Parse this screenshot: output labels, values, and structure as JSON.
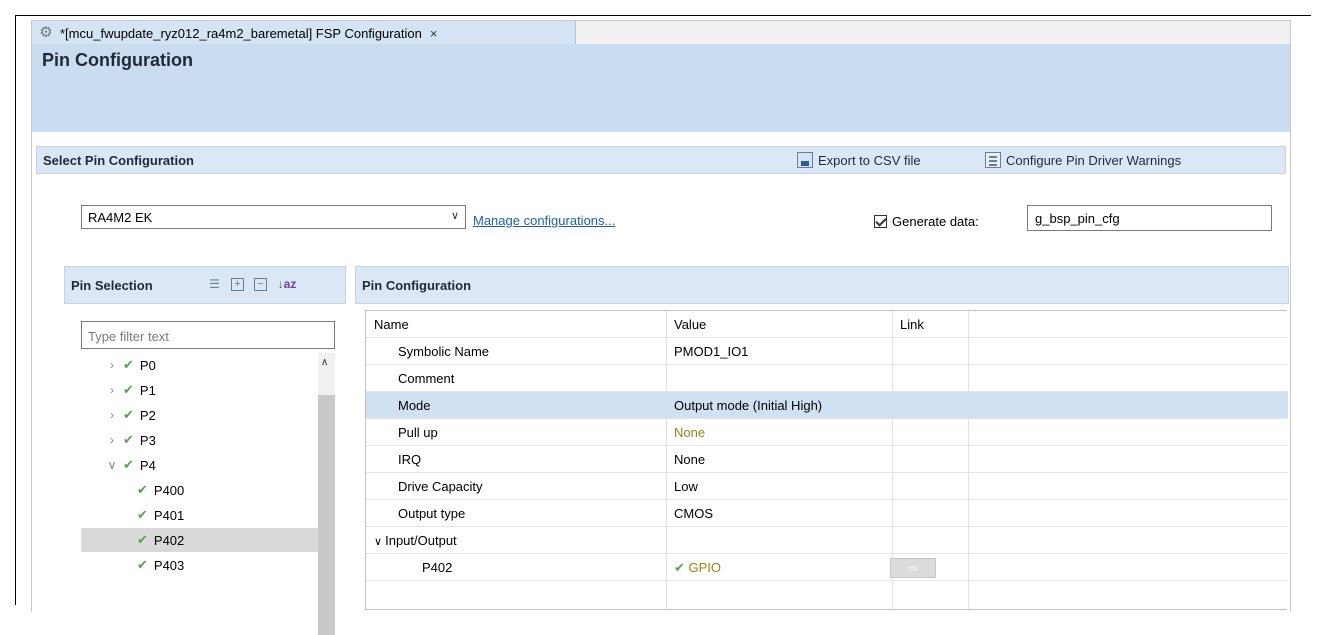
{
  "editor_tab": {
    "label": "*[mcu_fwupdate_ryz012_ra4m2_baremetal] FSP Configuration",
    "close": "×"
  },
  "page": {
    "title": "Pin Configuration"
  },
  "select_section": {
    "title": "Select Pin Configuration",
    "export_label": "Export to CSV file",
    "warnings_label": "Configure Pin Driver Warnings",
    "config_value": "RA4M2 EK",
    "manage_link": "Manage configurations...",
    "generate_label": "Generate data:",
    "generate_value": "g_bsp_pin_cfg"
  },
  "pin_selection": {
    "title": "Pin Selection",
    "filter_placeholder": "Type filter text",
    "tree": [
      {
        "label": "P0",
        "twisty": ">",
        "level": 0,
        "selected": false
      },
      {
        "label": "P1",
        "twisty": ">",
        "level": 0,
        "selected": false
      },
      {
        "label": "P2",
        "twisty": ">",
        "level": 0,
        "selected": false
      },
      {
        "label": "P3",
        "twisty": ">",
        "level": 0,
        "selected": false
      },
      {
        "label": "P4",
        "twisty": "v",
        "level": 0,
        "selected": false
      },
      {
        "label": "P400",
        "twisty": "",
        "level": 1,
        "selected": false
      },
      {
        "label": "P401",
        "twisty": "",
        "level": 1,
        "selected": false
      },
      {
        "label": "P402",
        "twisty": "",
        "level": 1,
        "selected": true
      },
      {
        "label": "P403",
        "twisty": "",
        "level": 1,
        "selected": false
      }
    ]
  },
  "pin_config": {
    "title": "Pin Configuration",
    "columns": {
      "name": "Name",
      "value": "Value",
      "link": "Link"
    },
    "rows": [
      {
        "name": "Symbolic Name",
        "value": "PMOD1_IO1"
      },
      {
        "name": "Comment",
        "value": ""
      },
      {
        "name": "Mode",
        "value": "Output mode (Initial High)"
      },
      {
        "name": "Pull up",
        "value": "None"
      },
      {
        "name": "IRQ",
        "value": "None"
      },
      {
        "name": "Drive Capacity",
        "value": "Low"
      },
      {
        "name": "Output type",
        "value": "CMOS"
      },
      {
        "name": "Input/Output",
        "value": ""
      },
      {
        "name": "P402",
        "value": "GPIO"
      }
    ]
  },
  "colors": {
    "header_blue": "#c9dcf0",
    "selection_blue": "#cfe1f3",
    "check_green": "#54a44a",
    "link_blue": "#1f5fae",
    "olive_value": "#8a8a1a"
  },
  "icons": {
    "tab": "gear-icon",
    "export": "csv-export-icon",
    "warnings": "warnings-config-icon",
    "tree_tick": "green-check-icon"
  }
}
